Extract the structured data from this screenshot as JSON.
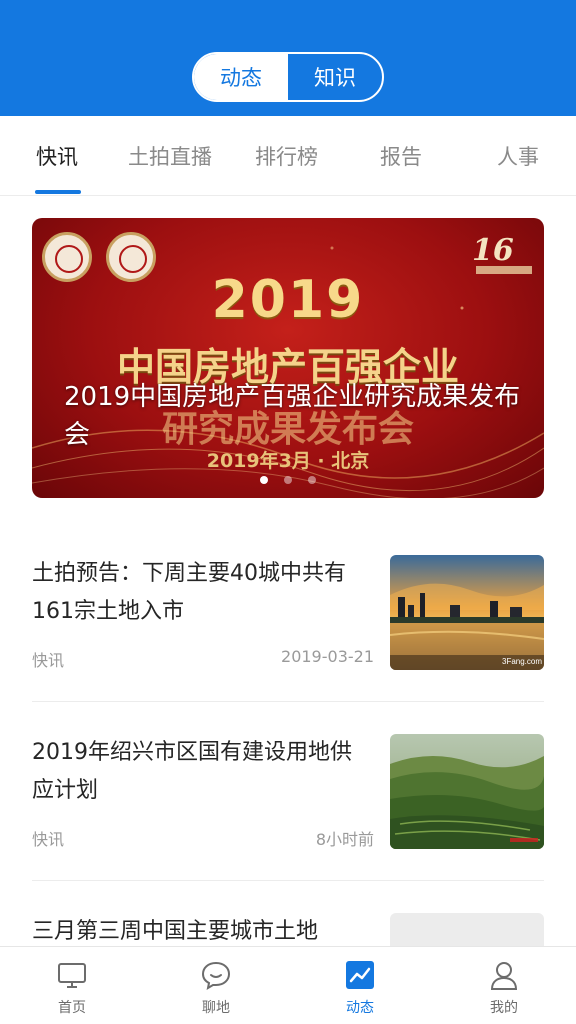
{
  "header": {
    "segments": [
      {
        "label": "动态",
        "active": true
      },
      {
        "label": "知识",
        "active": false
      }
    ],
    "background_color": "#1478e0"
  },
  "tabs": [
    {
      "label": "快讯",
      "active": true
    },
    {
      "label": "土拍直播",
      "active": false
    },
    {
      "label": "排行榜",
      "active": false
    },
    {
      "label": "报告",
      "active": false
    },
    {
      "label": "人事",
      "active": false
    }
  ],
  "banner": {
    "caption": "2019中国房地产百强企业研究成果发布会",
    "image_text": {
      "year": "2019",
      "line1": "中国房地产百强企业",
      "line2": "研究成果发布会",
      "date": "2019年3月 · 北京",
      "badge": "16"
    },
    "slides_total": 3,
    "current_slide": 1
  },
  "news": [
    {
      "title": "土拍预告：下周主要40城中共有161宗土地入市",
      "category": "快讯",
      "time": "2019-03-21",
      "thumb_watermark": "3Fang.com",
      "thumb": "city-skyline-sunset"
    },
    {
      "title": "2019年绍兴市区国有建设用地供应计划",
      "category": "快讯",
      "time": "8小时前",
      "thumb": "green-tea-hills"
    },
    {
      "title": "三月第三周中国主要城市土地",
      "category": "",
      "time": "",
      "thumb": "placeholder"
    }
  ],
  "bottom_nav": [
    {
      "label": "首页",
      "icon": "monitor-icon",
      "active": false
    },
    {
      "label": "聊地",
      "icon": "chat-icon",
      "active": false
    },
    {
      "label": "动态",
      "icon": "trend-chart-icon",
      "active": true
    },
    {
      "label": "我的",
      "icon": "user-icon",
      "active": false
    }
  ],
  "colors": {
    "accent": "#1478e0",
    "text_primary": "#262626",
    "text_secondary": "#9a9a9a"
  }
}
